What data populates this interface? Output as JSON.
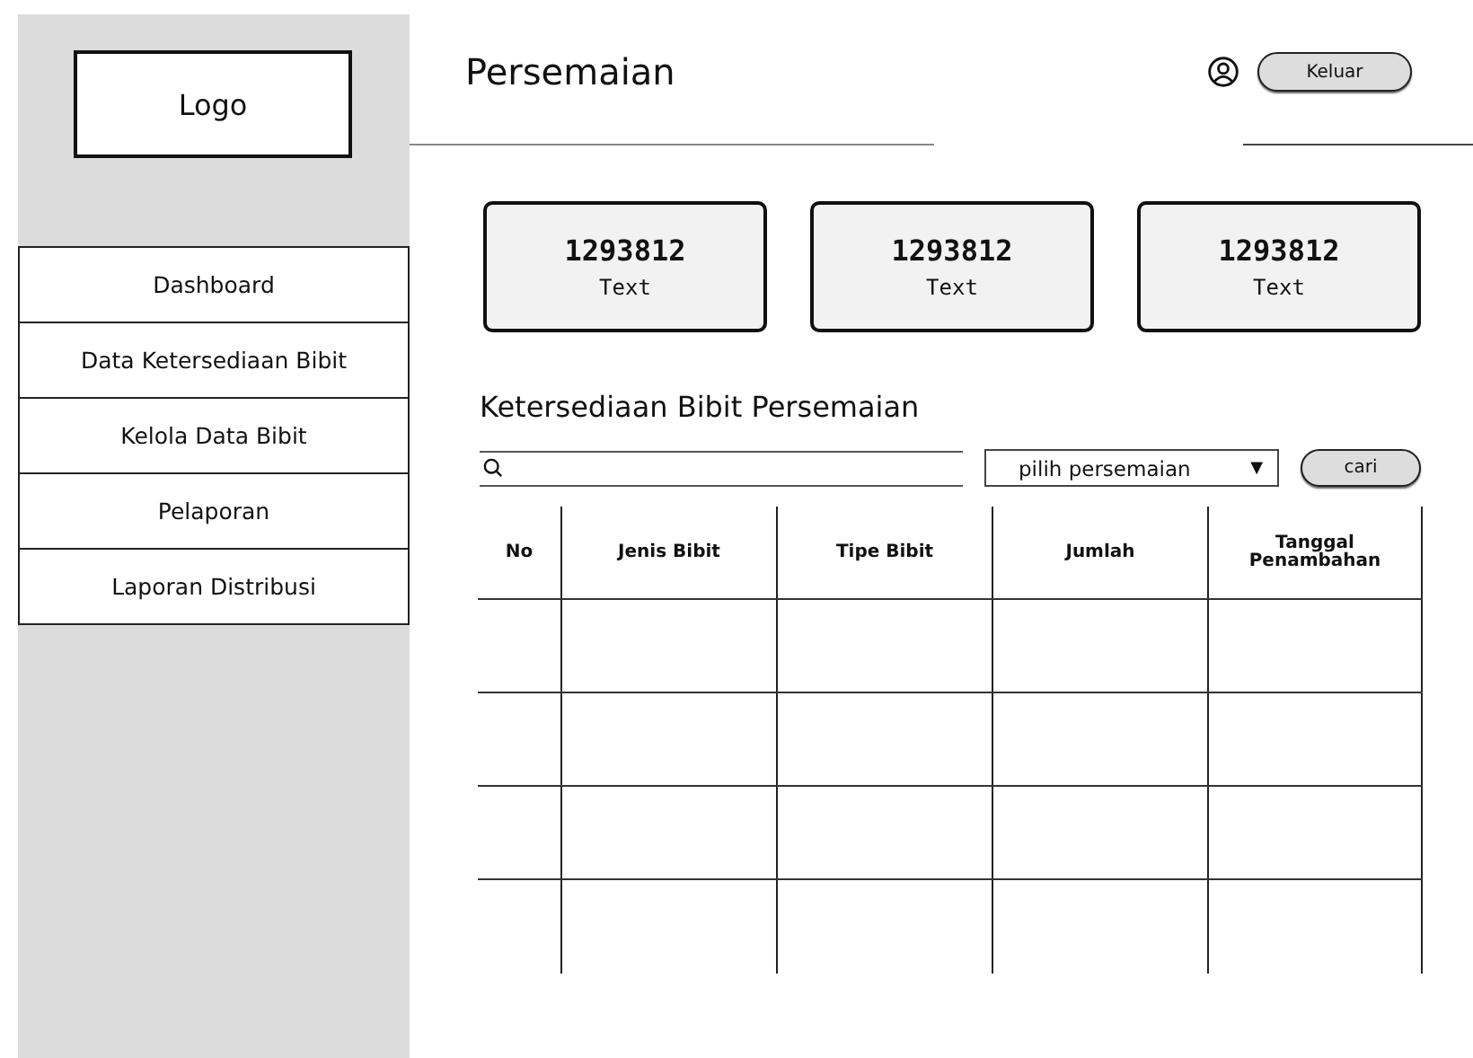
{
  "sidebar": {
    "logo": "Logo",
    "items": [
      {
        "label": "Dashboard",
        "selected": false
      },
      {
        "label": "Data Ketersediaan Bibit",
        "selected": false
      },
      {
        "label": "Kelola Data Bibit",
        "selected": false
      },
      {
        "label": "Pelaporan",
        "selected": false
      },
      {
        "label": "Laporan Distribusi",
        "selected": false
      }
    ]
  },
  "header": {
    "title": "Persemaian",
    "logout_button": "Keluar"
  },
  "stat_cards": [
    {
      "value": "1293812",
      "label": "Text"
    },
    {
      "value": "1293812",
      "label": "Text"
    },
    {
      "value": "1293812",
      "label": "Text"
    }
  ],
  "section_title": "Ketersediaan Bibit Persemaian",
  "filter": {
    "select": "pilih persemaian",
    "select_arrow": "▼",
    "search_button": "cari"
  },
  "table": {
    "columns": [
      "No",
      "Jenis Bibit",
      "Tipe Bibit",
      "Jumlah",
      "Tanggal Penambahan"
    ]
  }
}
